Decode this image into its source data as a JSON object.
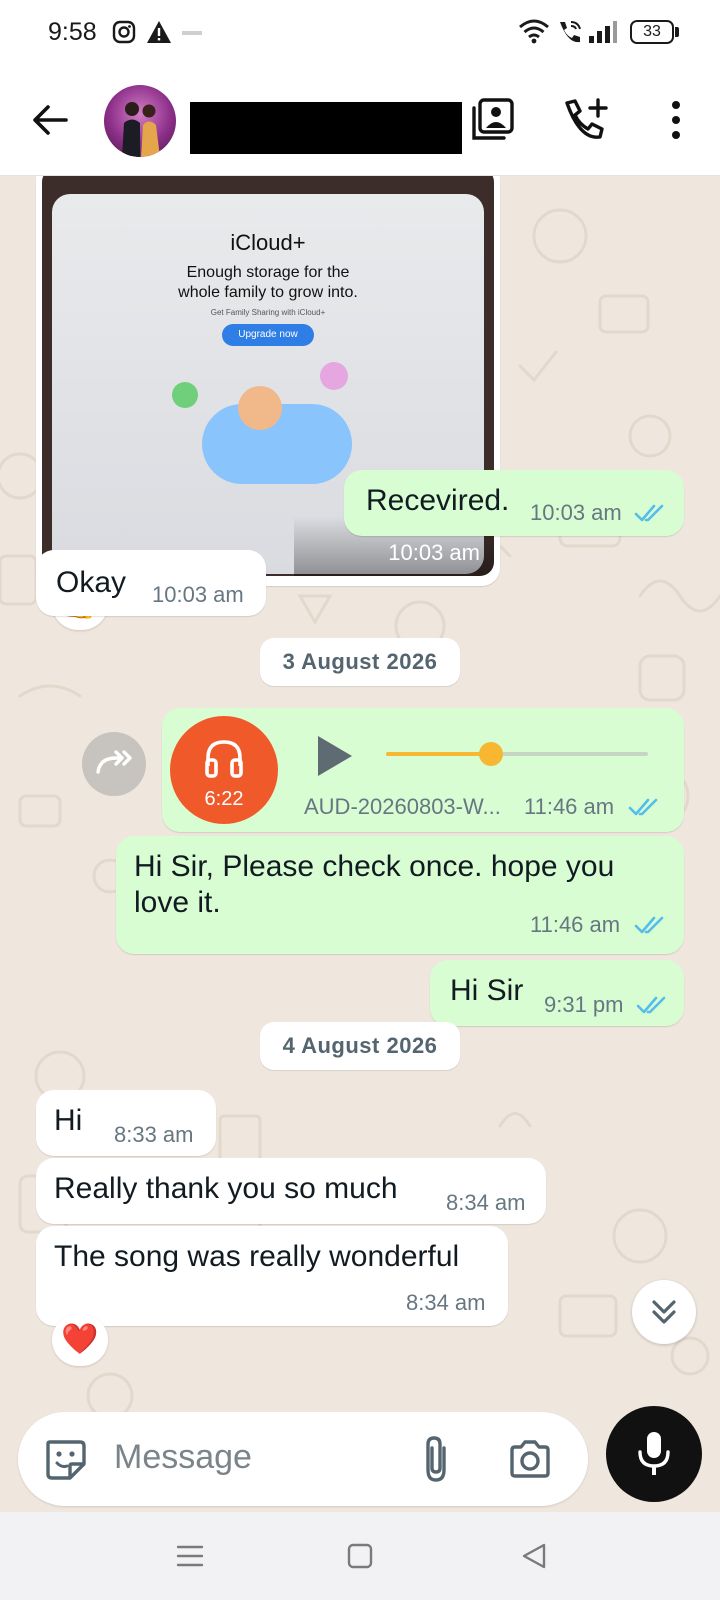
{
  "status_bar": {
    "time": "9:58",
    "battery": "33",
    "icons": [
      "instagram-icon",
      "alert-icon",
      "wifi-icon",
      "wifi-call-icon",
      "signal-icon",
      "battery-icon"
    ]
  },
  "header": {
    "icons": [
      "back-arrow-icon",
      "contact-card-icon",
      "add-call-icon",
      "more-vert-icon"
    ]
  },
  "messages": {
    "image_msg": {
      "time": "10:03 am",
      "reaction": "👍",
      "image": {
        "brand": "iCloud+",
        "line1": "Enough storage for the",
        "line2": "whole family to grow into.",
        "small": "Get Family Sharing with iCloud+",
        "button": "Upgrade now"
      }
    },
    "m1": {
      "text": "Recevired.",
      "time": "10:03 am"
    },
    "m2": {
      "text": "Okay",
      "time": "10:03 am"
    },
    "date1": "3 August 2026",
    "audio": {
      "duration": "6:22",
      "filename": "AUD-20260803-W...",
      "time": "11:46 am",
      "progress": 0.4
    },
    "m3": {
      "line1": "Hi Sir, Please check once. hope you",
      "line2": "love it.",
      "time": "11:46 am"
    },
    "m4": {
      "text": "Hi Sir",
      "time": "9:31 pm"
    },
    "date2": "4 August 2026",
    "m5": {
      "text": "Hi",
      "time": "8:33 am"
    },
    "m6": {
      "text": "Really thank you so much",
      "time": "8:34 am"
    },
    "m7": {
      "text": "The song was really wonderful",
      "time": "8:34 am",
      "reaction": "❤️"
    }
  },
  "composer": {
    "placeholder": "Message",
    "icons": [
      "sticker-icon",
      "attach-icon",
      "camera-icon",
      "mic-icon"
    ]
  },
  "colors": {
    "outgoing": "#d9fdd3",
    "incoming": "#ffffff",
    "read_tick": "#53bdeb",
    "audio_avatar": "#f05a2a",
    "audio_progress": "#f7b731"
  }
}
